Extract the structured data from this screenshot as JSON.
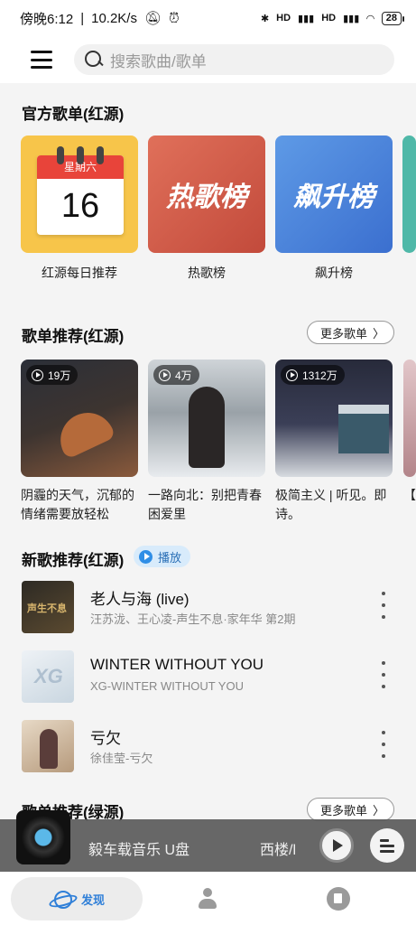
{
  "status": {
    "time": "傍晚6:12",
    "speed": "10.2K/s",
    "icons": [
      "mute-icon",
      "alarm-icon",
      "wifi-icon",
      "signal-icon",
      "bluetooth-icon"
    ],
    "signal1": "HD",
    "signal2": "HD",
    "battery": "28"
  },
  "search": {
    "placeholder": "搜索歌曲/歌单"
  },
  "official": {
    "title": "官方歌单(红源)",
    "calendar_weekday": "星期六",
    "calendar_day": "16",
    "hot_cover_text": "热歌榜",
    "rise_cover_text": "飙升榜",
    "cards": [
      {
        "label": "红源每日推荐"
      },
      {
        "label": "热歌榜"
      },
      {
        "label": "飙升榜"
      }
    ]
  },
  "playlists": {
    "title": "歌单推荐(红源)",
    "more": "更多歌单",
    "items": [
      {
        "count": "19万",
        "title": "阴霾的天气，沉郁的情绪需要放轻松"
      },
      {
        "count": "4万",
        "title": "一路向北：别把青春困爱里"
      },
      {
        "count": "1312万",
        "title": "极简主义 | 听见。即诗。"
      },
      {
        "title": "【作"
      }
    ]
  },
  "new_songs": {
    "title": "新歌推荐(红源)",
    "play": "播放",
    "items": [
      {
        "title": "老人与海 (live)",
        "sub": "汪苏泷、王心凌-声生不息·家年华 第2期"
      },
      {
        "title": "WINTER WITHOUT YOU",
        "sub": "XG-WINTER WITHOUT YOU"
      },
      {
        "title": "亏欠",
        "sub": "徐佳莹-亏欠"
      }
    ]
  },
  "green": {
    "title": "歌单推荐(绿源)",
    "more": "更多歌单"
  },
  "player": {
    "title": "毅车载音乐 U盘",
    "sub": "西楼/l"
  },
  "nav": {
    "discover": "发现"
  },
  "colors": {
    "accent": "#2f7fd8",
    "badge_bg": "#d8ebfb"
  }
}
